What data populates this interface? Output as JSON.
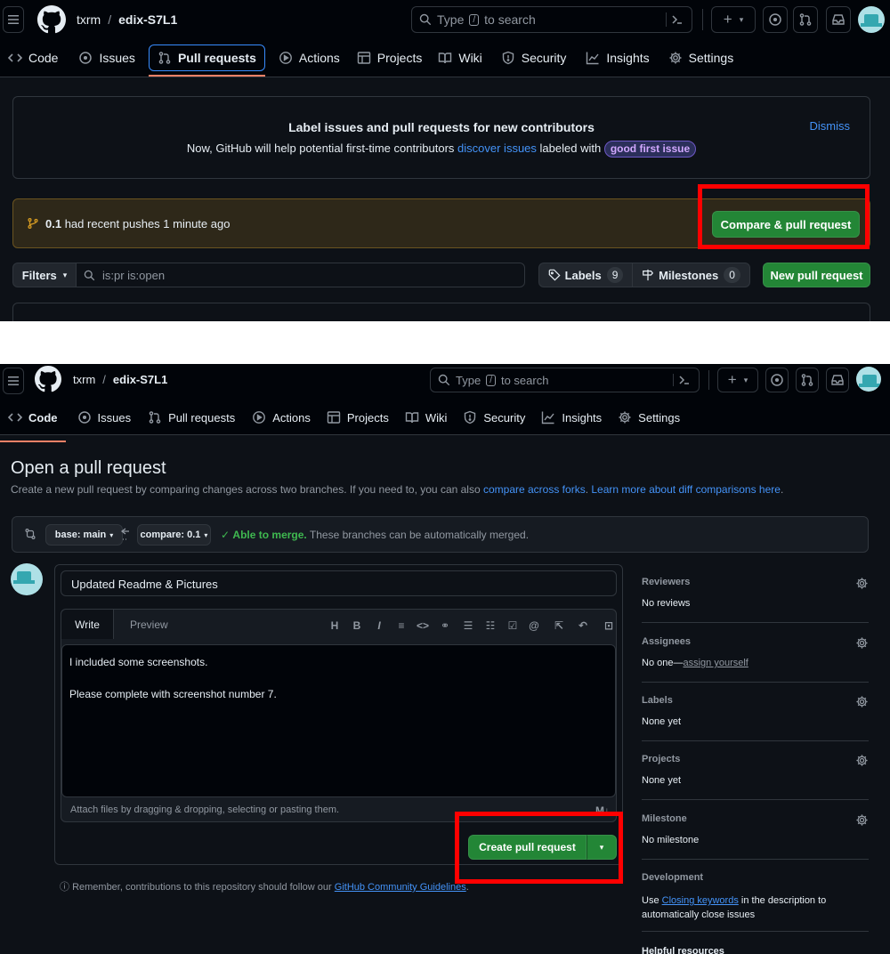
{
  "repo": {
    "owner": "txrm",
    "separator": "/",
    "name": "edix-S7L1"
  },
  "search": {
    "prefix": "Type",
    "key": "/",
    "suffix": "to search"
  },
  "tabs": [
    {
      "label": "Code",
      "icon": "code-icon"
    },
    {
      "label": "Issues",
      "icon": "issue-opened-icon"
    },
    {
      "label": "Pull requests",
      "icon": "git-pull-request-icon"
    },
    {
      "label": "Actions",
      "icon": "play-icon"
    },
    {
      "label": "Projects",
      "icon": "table-icon"
    },
    {
      "label": "Wiki",
      "icon": "book-icon"
    },
    {
      "label": "Security",
      "icon": "shield-icon"
    },
    {
      "label": "Insights",
      "icon": "graph-icon"
    },
    {
      "label": "Settings",
      "icon": "gear-icon"
    }
  ],
  "banner": {
    "title": "Label issues and pull requests for new contributors",
    "text_before": "Now, GitHub will help potential first-time contributors",
    "link": "discover issues",
    "text_after": "labeled with",
    "label": "good first issue",
    "dismiss": "Dismiss"
  },
  "recent_push": {
    "branch": "0.1",
    "text": "had recent pushes 1 minute ago",
    "button": "Compare & pull request"
  },
  "filter_bar": {
    "filters": "Filters",
    "query": "is:pr is:open",
    "labels": "Labels",
    "labels_count": "9",
    "milestones": "Milestones",
    "milestones_count": "0",
    "new_pr": "New pull request"
  },
  "compose": {
    "heading": "Open a pull request",
    "subtext": "Create a new pull request by comparing changes across two branches. If you need to, you can also",
    "link1": "compare across forks",
    "link2": "Learn more about diff comparisons here",
    "base": "base: main",
    "compare": "compare: 0.1",
    "merge_ok": "Able to merge.",
    "merge_text": "These branches can be automatically merged.",
    "title_value": "Updated Readme & Pictures",
    "tab_write": "Write",
    "tab_preview": "Preview",
    "body_line1": "I included some screenshots.",
    "body_line2": "Please complete with screenshot number 7.",
    "attach_hint": "Attach files by dragging & dropping, selecting or pasting them.",
    "create_button": "Create pull request",
    "guidelines_before": "Remember, contributions to this repository should follow our",
    "guidelines_link": "GitHub Community Guidelines",
    "guidelines_after": "."
  },
  "sidebar": {
    "reviewers": {
      "title": "Reviewers",
      "value": "No reviews"
    },
    "assignees": {
      "title": "Assignees",
      "value": "No one—",
      "link": "assign yourself"
    },
    "labels": {
      "title": "Labels",
      "value": "None yet"
    },
    "projects": {
      "title": "Projects",
      "value": "None yet"
    },
    "milestone": {
      "title": "Milestone",
      "value": "No milestone"
    },
    "development": {
      "title": "Development",
      "use": "Use",
      "link": "Closing keywords",
      "rest": "in the description to automatically close issues"
    },
    "helpful": {
      "title": "Helpful resources"
    }
  },
  "colors": {
    "highlight": "#ff0000",
    "green": "#238636",
    "accent": "#4493f8",
    "bg": "#0d1117"
  }
}
